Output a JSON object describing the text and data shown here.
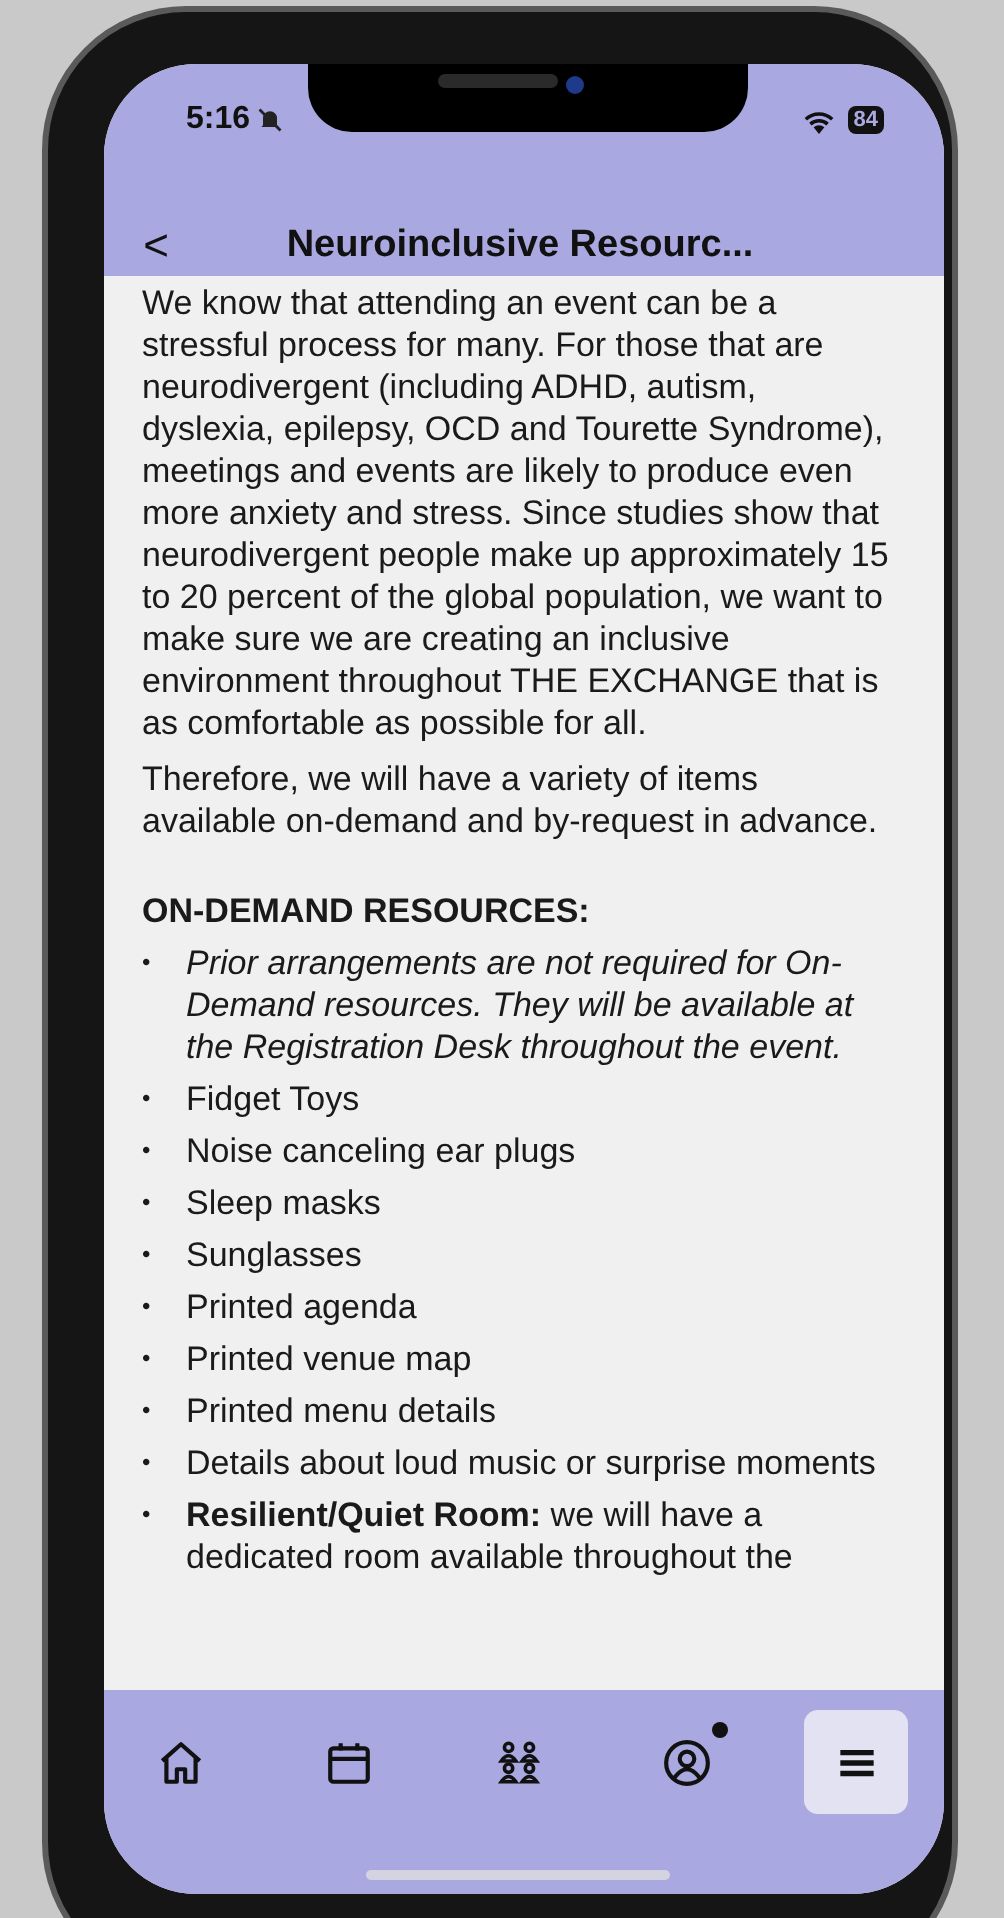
{
  "status_bar": {
    "time": "5:16",
    "battery": "84"
  },
  "header": {
    "back": "<",
    "title": "Neuroinclusive Resourc..."
  },
  "paragraphs": [
    "We know that attending an event can be a stressful process for many. For those that are neurodivergent (including ADHD, autism, dyslexia, epilepsy, OCD and Tourette Syndrome), meetings and events are likely to produce even more anxiety and stress. Since studies show that neurodivergent people make up approximately 15 to 20 percent of the global population, we want to make sure we are creating an inclusive environment throughout THE EXCHANGE that is as comfortable as possible for all.",
    "Therefore, we will have a variety of items available on-demand and by-request in advance."
  ],
  "section_heading": "ON-DEMAND RESOURCES:",
  "items": [
    {
      "kind": "note",
      "bullet": "•",
      "text": "Prior arrangements are not required for On-Demand resources. They will be available at the Registration Desk throughout the event."
    },
    {
      "kind": "plain",
      "bullet": "•",
      "text": "Fidget Toys"
    },
    {
      "kind": "plain",
      "bullet": "•",
      "text": "Noise canceling ear plugs"
    },
    {
      "kind": "plain",
      "bullet": "•",
      "text": "Sleep masks"
    },
    {
      "kind": "plain",
      "bullet": "•",
      "text": "Sunglasses"
    },
    {
      "kind": "plain",
      "bullet": "•",
      "text": "Printed agenda"
    },
    {
      "kind": "plain",
      "bullet": "•",
      "text": "Printed venue map"
    },
    {
      "kind": "plain",
      "bullet": "•",
      "text": "Printed menu details"
    },
    {
      "kind": "plain",
      "bullet": "•",
      "text": "Details about loud music or surprise moments"
    },
    {
      "kind": "plain",
      "bullet": "•",
      "text": "**Resilient/Quiet Room:** we will have a dedicated room available throughout the"
    }
  ],
  "nav": [
    {
      "kind": "home",
      "selected": false,
      "badge": false
    },
    {
      "kind": "calendar",
      "selected": false,
      "badge": false
    },
    {
      "kind": "people",
      "selected": false,
      "badge": false
    },
    {
      "kind": "profile",
      "selected": false,
      "badge": true
    },
    {
      "kind": "menu",
      "selected": true,
      "badge": false
    }
  ]
}
